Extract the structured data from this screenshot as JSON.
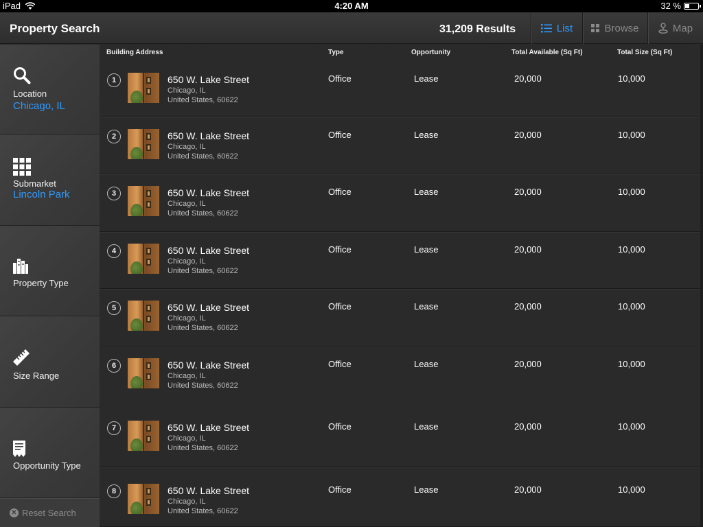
{
  "status_bar": {
    "device": "iPad",
    "time": "4:20 AM",
    "battery": "32 %",
    "battery_level": 0.32
  },
  "nav": {
    "title": "Property Search",
    "results": "31,209 Results",
    "segments": {
      "list": "List",
      "browse": "Browse",
      "map": "Map"
    },
    "accent_color": "#2e9bff"
  },
  "sidebar": {
    "location": {
      "label": "Location",
      "value": "Chicago, IL",
      "icon": "search-icon"
    },
    "submarket": {
      "label": "Submarket",
      "value": "Lincoln Park",
      "icon": "grid-icon"
    },
    "property_type": {
      "label": "Property Type",
      "icon": "buildings-icon"
    },
    "size_range": {
      "label": "Size Range",
      "icon": "ruler-icon"
    },
    "opportunity_type": {
      "label": "Opportunity Type",
      "icon": "receipt-icon"
    },
    "reset": "Reset Search"
  },
  "table": {
    "headers": {
      "address": "Building Address",
      "type": "Type",
      "opportunity": "Opportunity",
      "available": "Total Available (Sq Ft)",
      "size": "Total Size (Sq Ft)"
    },
    "rows": [
      {
        "num": "1",
        "street": "650 W. Lake Street",
        "city": "Chicago, IL",
        "country": "United States, 60622",
        "type": "Office",
        "opportunity": "Lease",
        "available": "20,000",
        "size": "10,000"
      },
      {
        "num": "2",
        "street": "650 W. Lake Street",
        "city": "Chicago, IL",
        "country": "United States, 60622",
        "type": "Office",
        "opportunity": "Lease",
        "available": "20,000",
        "size": "10,000"
      },
      {
        "num": "3",
        "street": "650 W. Lake Street",
        "city": "Chicago, IL",
        "country": "United States, 60622",
        "type": "Office",
        "opportunity": "Lease",
        "available": "20,000",
        "size": "10,000"
      },
      {
        "num": "4",
        "street": "650 W. Lake Street",
        "city": "Chicago, IL",
        "country": "United States, 60622",
        "type": "Office",
        "opportunity": "Lease",
        "available": "20,000",
        "size": "10,000"
      },
      {
        "num": "5",
        "street": "650 W. Lake Street",
        "city": "Chicago, IL",
        "country": "United States, 60622",
        "type": "Office",
        "opportunity": "Lease",
        "available": "20,000",
        "size": "10,000"
      },
      {
        "num": "6",
        "street": "650 W. Lake Street",
        "city": "Chicago, IL",
        "country": "United States, 60622",
        "type": "Office",
        "opportunity": "Lease",
        "available": "20,000",
        "size": "10,000"
      },
      {
        "num": "7",
        "street": "650 W. Lake Street",
        "city": "Chicago, IL",
        "country": "United States, 60622",
        "type": "Office",
        "opportunity": "Lease",
        "available": "20,000",
        "size": "10,000"
      },
      {
        "num": "8",
        "street": "650 W. Lake Street",
        "city": "Chicago, IL",
        "country": "United States, 60622",
        "type": "Office",
        "opportunity": "Lease",
        "available": "20,000",
        "size": "10,000"
      }
    ]
  }
}
